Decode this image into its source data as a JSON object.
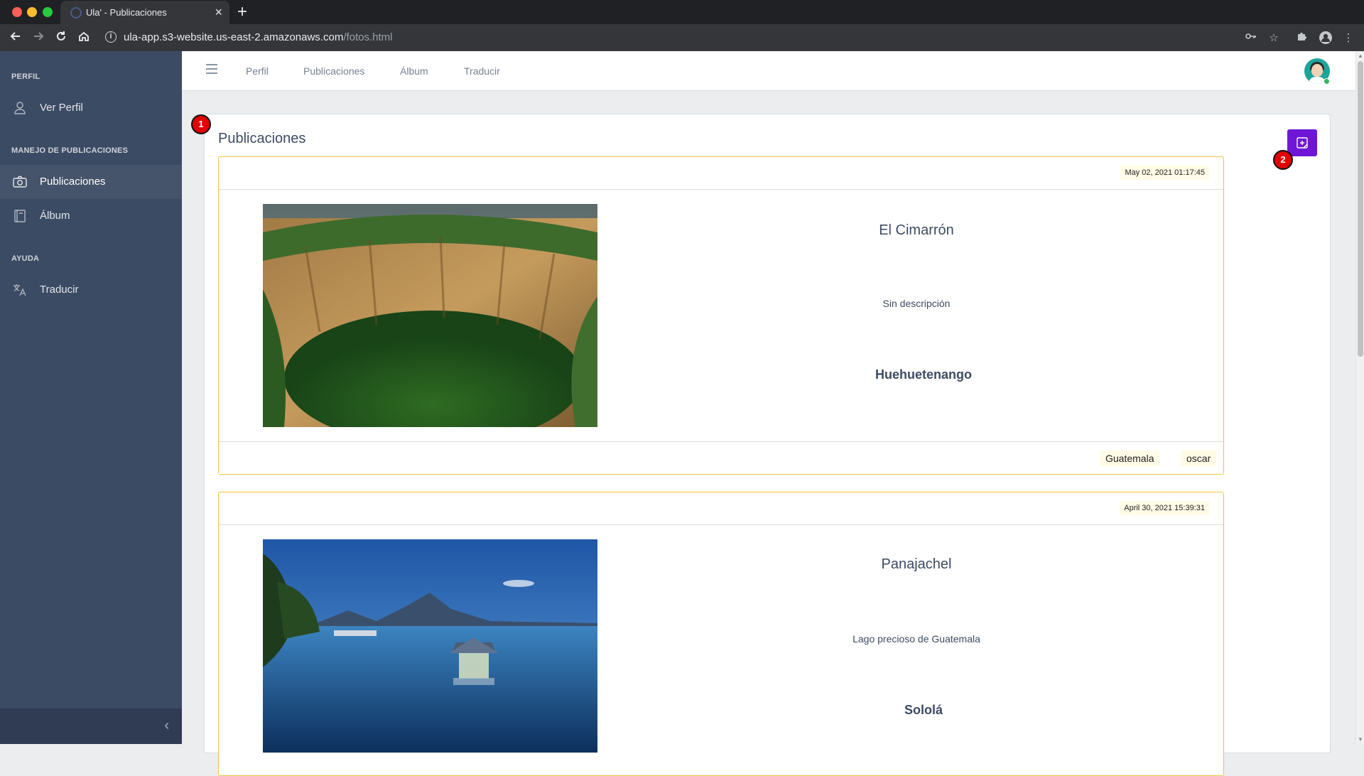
{
  "browser": {
    "tab_title": "Ula' - Publicaciones",
    "url_host": "ula-app.s3-website.us-east-2.amazonaws.com",
    "url_path": "/fotos.html"
  },
  "sidebar": {
    "sections": [
      {
        "heading": "PERFIL",
        "items": [
          {
            "label": "Ver Perfil",
            "icon": "user-icon"
          }
        ]
      },
      {
        "heading": "MANEJO DE PUBLICACIONES",
        "items": [
          {
            "label": "Publicaciones",
            "icon": "camera-icon",
            "active": true
          },
          {
            "label": "Álbum",
            "icon": "album-icon"
          }
        ]
      },
      {
        "heading": "AYUDA",
        "items": [
          {
            "label": "Traducir",
            "icon": "translate-icon"
          }
        ]
      }
    ]
  },
  "header": {
    "nav": [
      "Perfil",
      "Publicaciones",
      "Álbum",
      "Traducir"
    ]
  },
  "main": {
    "title": "Publicaciones",
    "annotations": [
      "1",
      "2"
    ],
    "accent_color": "#6f16d6",
    "card_border_color": "#f3c53d"
  },
  "posts": [
    {
      "date": "May 02, 2021 01:17:45",
      "title": "El Cimarrón",
      "description": "Sin descripción",
      "location": "Huehuetenango",
      "tags": [
        "Guatemala",
        "oscar"
      ]
    },
    {
      "date": "April 30, 2021 15:39:31",
      "title": "Panajachel",
      "description": "Lago precioso de Guatemala",
      "location": "Sololá",
      "tags": []
    }
  ]
}
